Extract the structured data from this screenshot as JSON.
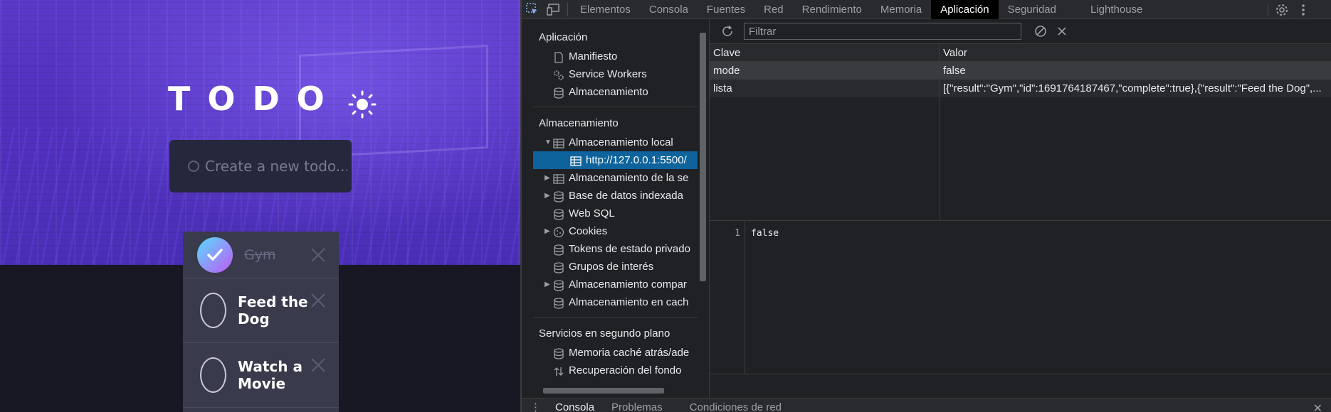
{
  "app": {
    "title": "TODO",
    "new_todo_placeholder": "Create a new todo...",
    "todos": [
      {
        "text": "Gym",
        "complete": true
      },
      {
        "text": "Feed the Dog",
        "complete": false
      },
      {
        "text": "Watch a Movie",
        "complete": false
      }
    ],
    "colors": {
      "hero": "#5231bf",
      "card": "#393a4c",
      "check_gradient": [
        "#57ddff",
        "#c058f3"
      ]
    }
  },
  "devtools": {
    "tabs": [
      "Elementos",
      "Consola",
      "Fuentes",
      "Red",
      "Rendimiento",
      "Memoria",
      "Aplicación",
      "Seguridad",
      "Lighthouse"
    ],
    "active_tab": "Aplicación",
    "sidebar": {
      "section_app": "Aplicación",
      "app_items": [
        "Manifiesto",
        "Service Workers",
        "Almacenamiento"
      ],
      "section_storage": "Almacenamiento",
      "storage_items": {
        "local": "Almacenamiento local",
        "local_origin": "http://127.0.0.1:5500/",
        "session": "Almacenamiento de la se",
        "indexeddb": "Base de datos indexada",
        "websql": "Web SQL",
        "cookies": "Cookies",
        "trust_tokens": "Tokens de estado privado",
        "interest_groups": "Grupos de interés",
        "shared": "Almacenamiento compar",
        "cache": "Almacenamiento en cach"
      },
      "section_bg": "Servicios en segundo plano",
      "bg_items": [
        "Memoria caché atrás/ade",
        "Recuperación del fondo"
      ]
    },
    "filter_placeholder": "Filtrar",
    "table": {
      "headers": [
        "Clave",
        "Valor"
      ],
      "rows": [
        {
          "key": "mode",
          "value": "false"
        },
        {
          "key": "lista",
          "value": "[{\"result\":\"Gym\",\"id\":1691764187467,\"complete\":true},{\"result\":\"Feed the Dog\",..."
        }
      ]
    },
    "preview": {
      "line_number": "1",
      "content": "false"
    },
    "drawer_tabs": [
      "Consola",
      "Problemas",
      "Condiciones de red"
    ],
    "drawer_active": "Consola",
    "colors": {
      "selected": "#0e639c",
      "panel": "#202124",
      "toolbar": "#292a2d"
    }
  }
}
